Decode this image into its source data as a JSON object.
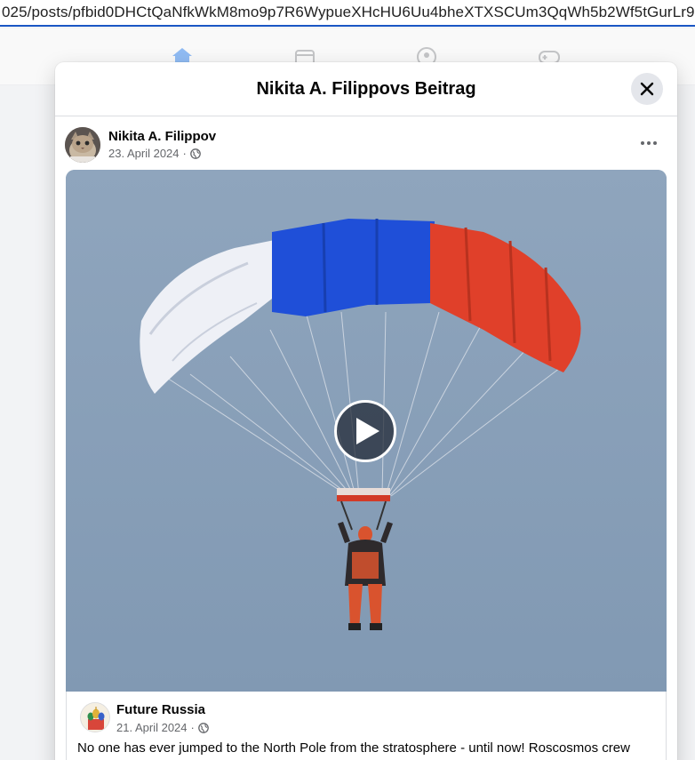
{
  "browser": {
    "url_text": "025/posts/pfbid0DHCtQaNfkWkM8mo9p7R6WypueXHcHU6Uu4bheXTXSCUm3QqWh5b2Wf5tGurLr9"
  },
  "nav": {
    "icons": [
      "home-icon",
      "marketplace-icon",
      "groups-icon",
      "gaming-icon"
    ]
  },
  "dialog": {
    "title": "Nikita A. Filippovs Beitrag",
    "close_icon": "close-icon"
  },
  "post": {
    "author": "Nikita A. Filippov",
    "date": "23. April 2024",
    "separator": "·",
    "audience_icon": "globe-icon",
    "more_icon": "more-options-icon"
  },
  "media": {
    "type": "video",
    "play_icon": "play-icon"
  },
  "shared_post": {
    "author": "Future Russia",
    "date": "21. April 2024",
    "separator": "·",
    "audience_icon": "globe-icon",
    "text": "No one has ever jumped to the North Pole from the stratosphere - until now! Roscosmos crew"
  },
  "colors": {
    "facebook_blue": "#1877f2",
    "secondary_text": "#65676b",
    "parachute_white": "#eef0f6",
    "parachute_blue": "#1f4fd8",
    "parachute_red": "#e0402a"
  }
}
